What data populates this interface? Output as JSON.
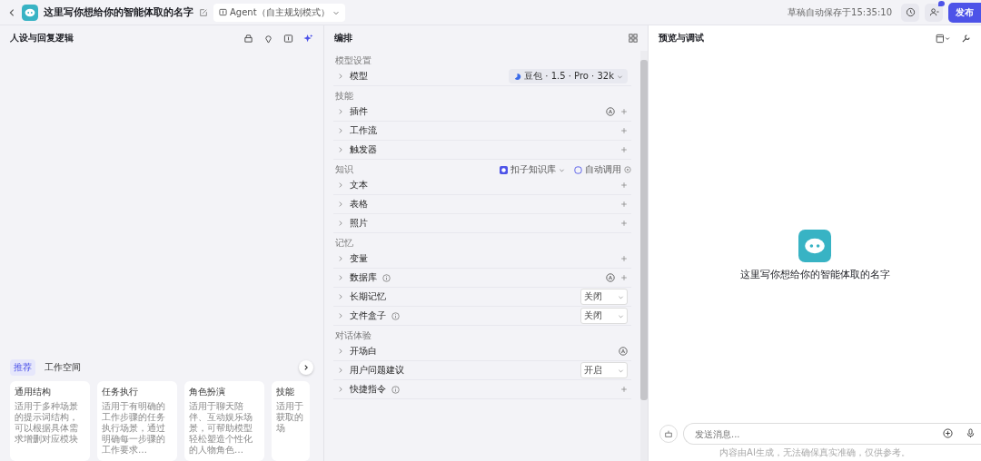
{
  "topbar": {
    "title": "这里写你想给你的智能体取的名字",
    "mode": "Agent（自主规划模式）",
    "save_status": "草稿自动保存于15:35:10",
    "collab_badge": true,
    "publish": "发布"
  },
  "persona": {
    "title": "人设与回复逻辑",
    "tabs": [
      {
        "label": "推荐",
        "selected": true
      },
      {
        "label": "工作空间",
        "selected": false
      }
    ],
    "templates": [
      {
        "title": "通用结构",
        "desc": "适用于多种场景的提示词结构，可以根据具体需求增删对应模块"
      },
      {
        "title": "任务执行",
        "desc": "适用于有明确的工作步骤的任务执行场景，通过明确每一步骤的工作要求…"
      },
      {
        "title": "角色扮演",
        "desc": "适用于聊天陪伴、互动娱乐场景，可帮助模型轻松塑造个性化的人物角色…"
      },
      {
        "title": "技能",
        "desc": "适用于获取的场"
      }
    ]
  },
  "orchestration": {
    "title": "编排",
    "sections": [
      {
        "title": "模型设置",
        "rows": [
          {
            "label": "模型",
            "kind": "model",
            "value": "豆包 · 1.5 · Pro · 32k",
            "info": false,
            "auto": false,
            "add": false
          }
        ]
      },
      {
        "title": "技能",
        "rows": [
          {
            "label": "插件",
            "kind": "plain",
            "info": false,
            "auto": true,
            "add": true
          },
          {
            "label": "工作流",
            "kind": "plain",
            "info": false,
            "auto": false,
            "add": true
          },
          {
            "label": "触发器",
            "kind": "plain",
            "info": false,
            "auto": false,
            "add": true
          }
        ]
      },
      {
        "title": "知识",
        "source": "扣子知识库",
        "call_mode": "自动调用",
        "rows": [
          {
            "label": "文本",
            "kind": "plain",
            "info": false,
            "auto": false,
            "add": true
          },
          {
            "label": "表格",
            "kind": "plain",
            "info": false,
            "auto": false,
            "add": true
          },
          {
            "label": "照片",
            "kind": "plain",
            "info": false,
            "auto": false,
            "add": true
          }
        ]
      },
      {
        "title": "记忆",
        "rows": [
          {
            "label": "变量",
            "kind": "plain",
            "info": false,
            "auto": false,
            "add": true
          },
          {
            "label": "数据库",
            "kind": "plain",
            "info": true,
            "auto": true,
            "add": true
          },
          {
            "label": "长期记忆",
            "kind": "select",
            "value": "关闭",
            "info": false,
            "auto": false,
            "add": false
          },
          {
            "label": "文件盒子",
            "kind": "select",
            "value": "关闭",
            "info": true,
            "auto": false,
            "add": false
          }
        ]
      },
      {
        "title": "对话体验",
        "rows": [
          {
            "label": "开场白",
            "kind": "plain",
            "info": false,
            "auto": true,
            "add": false
          },
          {
            "label": "用户问题建议",
            "kind": "select",
            "value": "开启",
            "info": false,
            "auto": false,
            "add": false
          },
          {
            "label": "快捷指令",
            "kind": "plain",
            "info": true,
            "auto": false,
            "add": true
          }
        ]
      }
    ]
  },
  "preview": {
    "title": "预览与调试",
    "bot_name": "这里写你想给你的智能体取的名字",
    "input": {
      "placeholder": "发送消息..."
    },
    "disclaimer": "内容由AI生成，无法确保真实准确，仅供参考。"
  }
}
